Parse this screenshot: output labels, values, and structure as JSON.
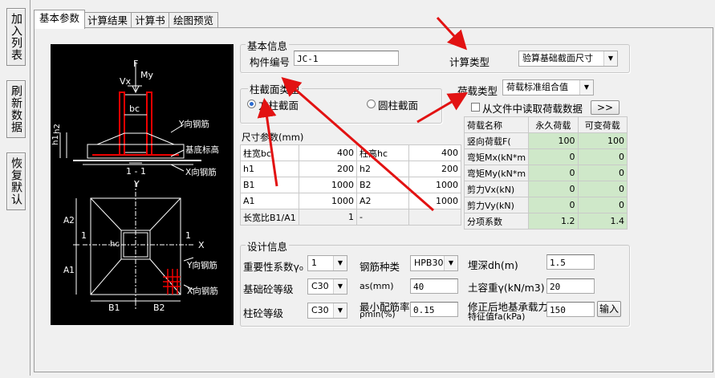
{
  "sidebar": {
    "buttons": [
      "加入列表",
      "刷新数据",
      "恢复默认"
    ]
  },
  "tabs": [
    "基本参数",
    "计算结果",
    "计算书",
    "绘图预览"
  ],
  "basic_info": {
    "title": "基本信息",
    "member_no_label": "构件编号",
    "member_no_value": "JC-1",
    "calc_type_label": "计算类型",
    "calc_type_value": "验算基础截面尺寸"
  },
  "column_section": {
    "title": "柱截面类型",
    "options": [
      "方柱截面",
      "圆柱截面"
    ],
    "selected": "方柱截面"
  },
  "load": {
    "type_label": "荷载类型",
    "type_value": "荷载标准组合值",
    "from_file_label": "从文件中读取荷载数据",
    "more_button": ">>",
    "headers": [
      "荷载名称",
      "永久荷载",
      "可变荷载"
    ],
    "rows": [
      [
        "竖向荷载F(",
        "100",
        "100"
      ],
      [
        "弯矩Mx(kN*m",
        "0",
        "0"
      ],
      [
        "弯矩My(kN*m",
        "0",
        "0"
      ],
      [
        "剪力Vx(kN)",
        "0",
        "0"
      ],
      [
        "剪力Vy(kN)",
        "0",
        "0"
      ],
      [
        "分项系数",
        "1.2",
        "1.4"
      ]
    ]
  },
  "dimensions": {
    "title": "尺寸参数(mm)",
    "rows": [
      [
        "柱宽bc",
        "400",
        "柱高hc",
        "400"
      ],
      [
        "h1",
        "200",
        "h2",
        "200"
      ],
      [
        "B1",
        "1000",
        "B2",
        "1000"
      ],
      [
        "A1",
        "1000",
        "A2",
        "1000"
      ],
      [
        "长宽比B1/A1",
        "1",
        "-",
        ""
      ]
    ]
  },
  "design": {
    "title": "设计信息",
    "importance_label": "重要性系数γ₀",
    "importance_value": "1",
    "rebar_label": "钢筋种类",
    "rebar_value": "HPB300",
    "depth_label": "埋深dh(m)",
    "depth_value": "1.5",
    "found_concrete_label": "基础砼等级",
    "found_concrete_value": "C30",
    "as_label": "as(mm)",
    "as_value": "40",
    "soil_weight_label": "土容重γ(kN/m3)",
    "soil_weight_value": "20",
    "col_concrete_label": "柱砼等级",
    "col_concrete_value": "C30",
    "min_ratio_label_1": "最小配筋率",
    "min_ratio_label_2": "ρmin(%)",
    "min_ratio_value": "0.15",
    "bearing_label_1": "修正后地基承载力",
    "bearing_label_2": "特征值fa(kPa)",
    "bearing_value": "150",
    "input_button": "输入"
  },
  "drawing": {
    "labels": [
      "F",
      "Vx",
      "My",
      "bc",
      "Y向钢筋",
      "基底标高",
      "X向钢筋",
      "h1",
      "h2",
      "1 - 1",
      "Y",
      "1",
      "1",
      "X",
      "hc",
      "A2",
      "A1",
      "B1",
      "B2",
      "Y向钢筋",
      "X向钢筋"
    ]
  }
}
